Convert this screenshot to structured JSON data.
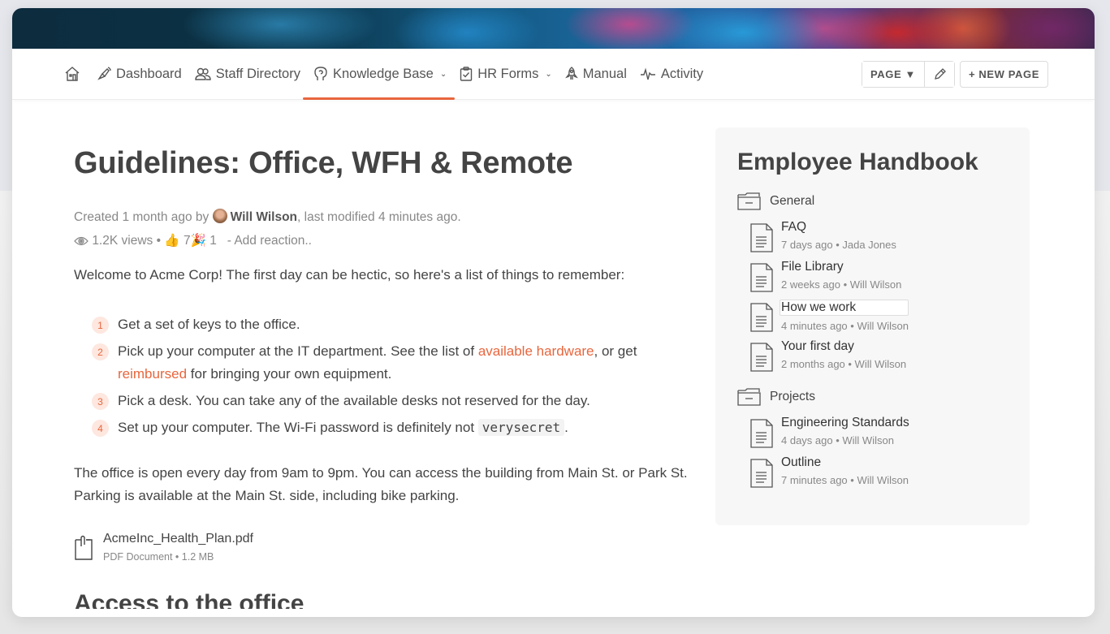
{
  "nav": {
    "items": [
      {
        "label": "Dashboard",
        "icon": "megaphone-icon"
      },
      {
        "label": "Staff Directory",
        "icon": "people-icon"
      },
      {
        "label": "Knowledge Base",
        "icon": "head-icon",
        "dropdown": true,
        "active": true
      },
      {
        "label": "HR Forms",
        "icon": "clipboard-icon",
        "dropdown": true
      },
      {
        "label": "Manual",
        "icon": "rocket-icon"
      },
      {
        "label": "Activity",
        "icon": "pulse-icon"
      }
    ],
    "page_button": "PAGE ▼",
    "new_page_button": "+ NEW PAGE",
    "accent_color": "#e8663d"
  },
  "article": {
    "title": "Guidelines: Office, WFH & Remote",
    "meta": {
      "created_prefix": "Created 1 month ago by",
      "author": "Will Wilson",
      "modified_suffix": ", last modified 4 minutes ago.",
      "views": "1.2K views •",
      "thumbs_count": "7",
      "party_count": "1",
      "add_reaction": "- Add reaction.."
    },
    "intro": "Welcome to Acme Corp! The first day can be hectic, so here's a list of things to remember:",
    "steps": [
      {
        "num": "1",
        "text": "Get a set of keys to the office."
      },
      {
        "num": "2",
        "text_a": "Pick up your computer at the IT department. See the list of",
        "link_a": "available hardware",
        "text_b": ", or get",
        "link_b": "reimbursed",
        "text_c": "for bringing your own equipment."
      },
      {
        "num": "3",
        "text": "Pick a desk. You can take any of the available desks not reserved for the day."
      },
      {
        "num": "4",
        "text": "Set up your computer. The Wi-Fi password is definitely not",
        "code": "verysecret",
        "suffix": "."
      }
    ],
    "paragraph": "The office is open every day from 9am to 9pm. You can access the building from Main St. or Park St. Parking is available at the Main St. side, including bike parking.",
    "attachment": {
      "name": "AcmeInc_Health_Plan.pdf",
      "meta": "PDF Document • 1.2 MB"
    },
    "section_heading": "Access to the office"
  },
  "sidebar": {
    "title": "Employee Handbook",
    "folders": [
      {
        "name": "General",
        "docs": [
          {
            "title": "FAQ",
            "meta": "7 days ago • Jada Jones"
          },
          {
            "title": "File Library",
            "meta": "2 weeks ago • Will Wilson"
          },
          {
            "title": "How we work",
            "meta": "4 minutes ago • Will Wilson"
          },
          {
            "title": "Your first day",
            "meta": "2 months ago • Will Wilson"
          }
        ]
      },
      {
        "name": "Projects",
        "docs": [
          {
            "title": "Engineering Standards",
            "meta": "4 days ago • Will Wilson"
          },
          {
            "title": "Outline",
            "meta": "7 minutes ago • Will Wilson"
          }
        ]
      }
    ]
  }
}
